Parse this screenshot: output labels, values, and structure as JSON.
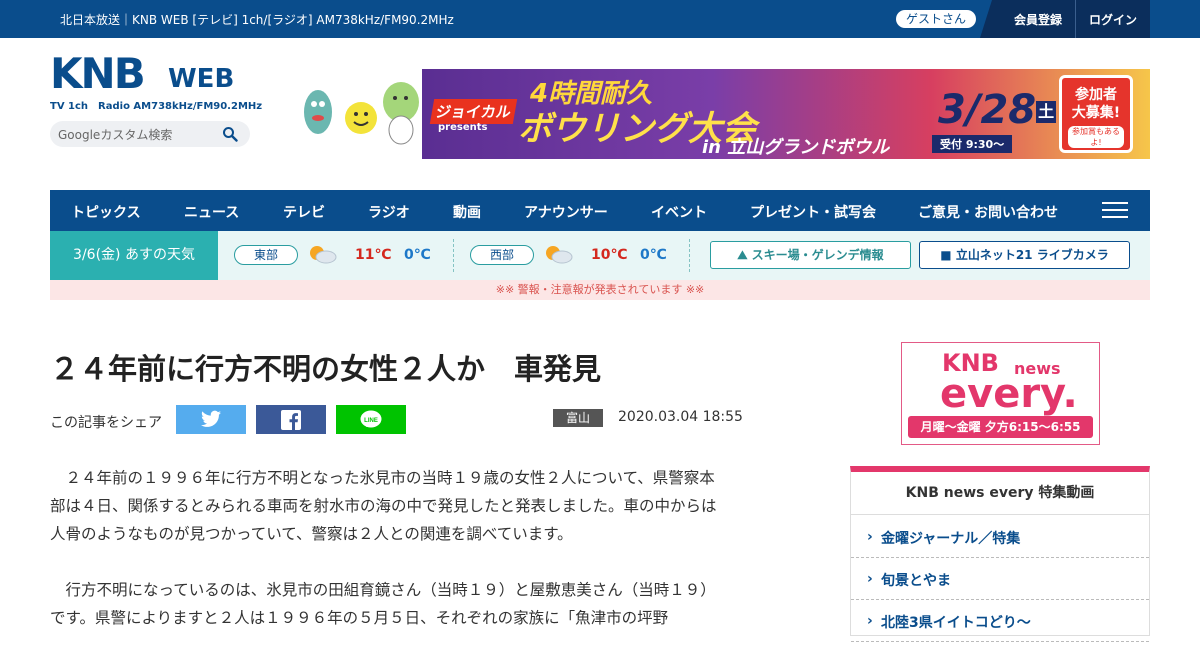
{
  "topbar": {
    "station": "北日本放送｜KNB WEB [テレビ] 1ch/[ラジオ] AM738kHz/FM90.2MHz",
    "guest": "ゲストさん",
    "register": "会員登録",
    "login": "ログイン"
  },
  "logo": {
    "main": "KNB",
    "web": "WEB",
    "sub": "TV 1ch　Radio AM738kHz/FM90.2MHz"
  },
  "search": {
    "placeholder": "Googleカスタム検索"
  },
  "banner": {
    "brand": "ジョイカル",
    "presents": "presents",
    "line1": "4時間耐久",
    "line2": "ボウリング大会",
    "line3": "in 立山グランドボウル",
    "date": "3/28",
    "dow": "土",
    "reception": "受付 9:30～",
    "cta": "参加者\n大募集!",
    "cta_sub": "参加賞もあるよ!"
  },
  "nav": {
    "items": [
      "トピックス",
      "ニュース",
      "テレビ",
      "ラジオ",
      "動画",
      "アナウンサー",
      "イベント",
      "プレゼント・試写会",
      "ご意見・お問い合わせ"
    ]
  },
  "weather": {
    "day": "3/6(金) あすの天気",
    "east": {
      "region": "東部",
      "high": "11℃",
      "low": "0℃"
    },
    "west": {
      "region": "西部",
      "high": "10℃",
      "low": "0℃"
    },
    "ski": "スキー場・ゲレンデ情報",
    "camera": "立山ネット21 ライブカメラ"
  },
  "alert": "※※ 警報・注意報が発表されています ※※",
  "article": {
    "title": "２４年前に行方不明の女性２人か　車発見",
    "share_label": "この記事をシェア",
    "area": "富山",
    "datetime": "2020.03.04 18:55",
    "p1": "　２４年前の１９９６年に行方不明となった氷見市の当時１９歳の女性２人について、県警察本部は４日、関係するとみられる車両を射水市の海の中で発見したと発表しました。車の中からは人骨のようなものが見つかっていて、警察は２人との関連を調べています。",
    "p2": "　行方不明になっているのは、氷見市の田組育鏡さん（当時１９）と屋敷恵美さん（当時１９）です。県警によりますと２人は１９９６年の５月５日、それぞれの家族に「魚津市の坪野"
  },
  "promo": {
    "knb": "KNB",
    "news": "news",
    "every": "every.",
    "time": "月曜～金曜 夕方6:15～6:55"
  },
  "sidebox": {
    "title": "KNB news every 特集動画",
    "items": [
      "金曜ジャーナル／特集",
      "旬景とやま",
      "北陸3県イイトコどり～"
    ]
  },
  "colors": {
    "brand": "#0a4d8c",
    "teal": "#2bb0b0",
    "pink": "#e3376b",
    "twitter": "#55acee",
    "facebook": "#3b5998",
    "line": "#00c300"
  }
}
